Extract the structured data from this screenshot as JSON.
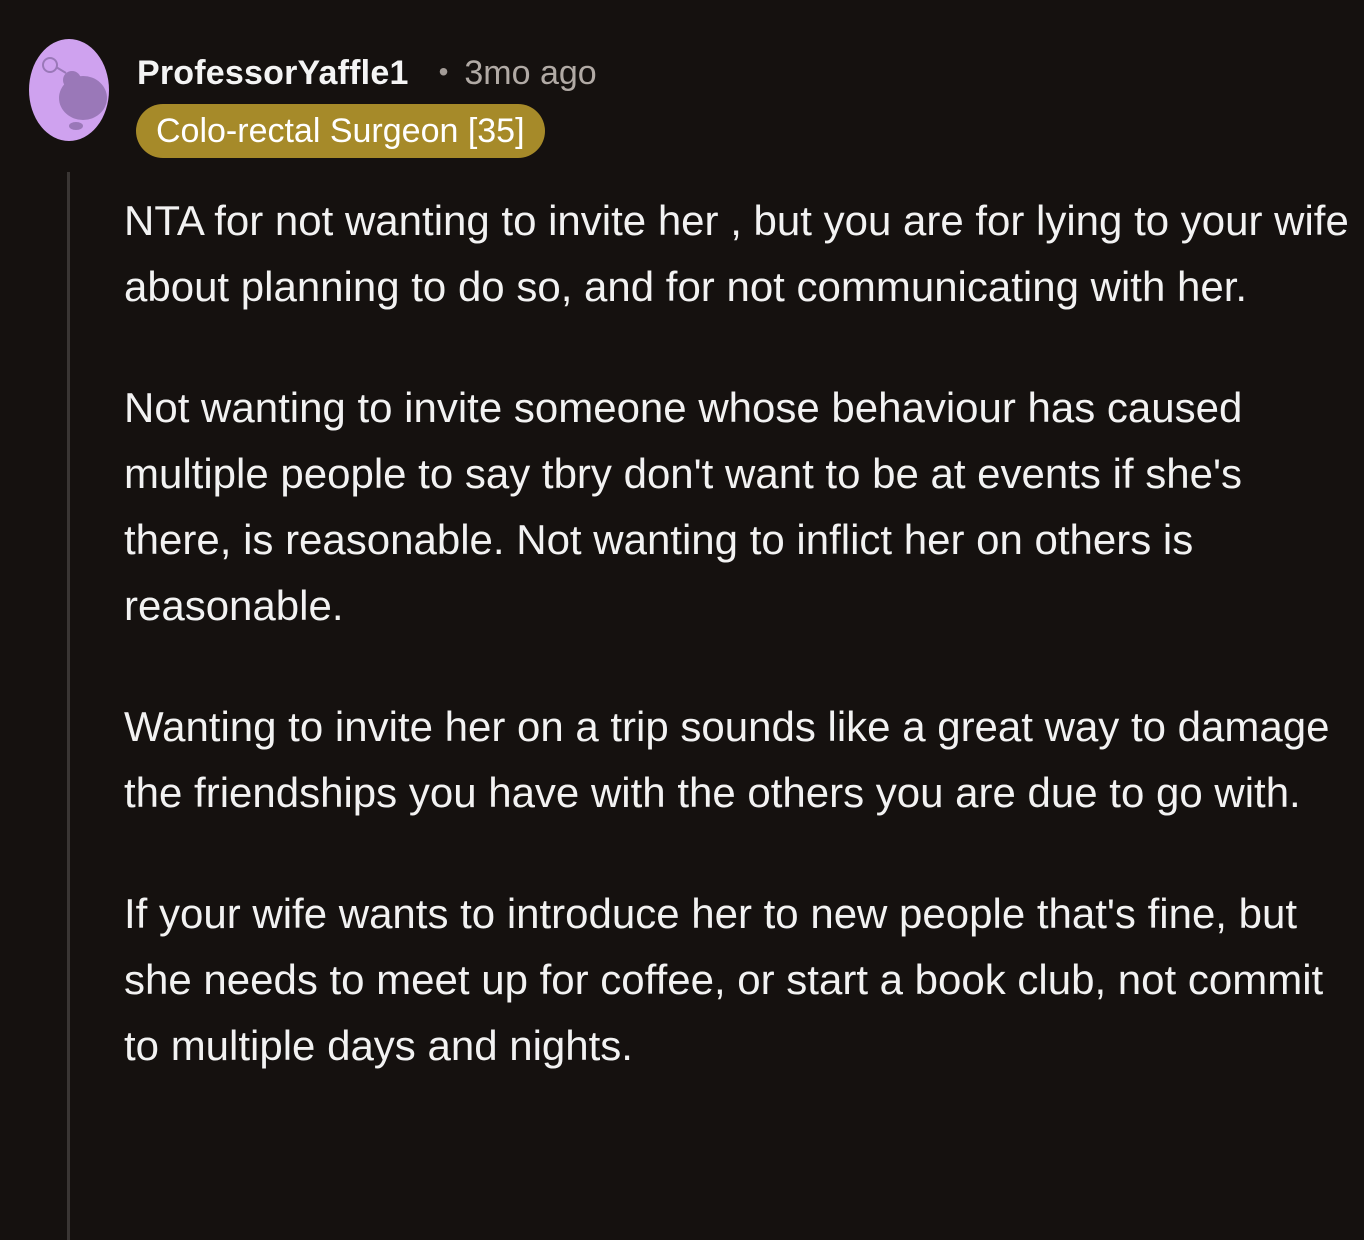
{
  "comment": {
    "author": "ProfessorYaffle1",
    "separator": "•",
    "timestamp": "3mo ago",
    "flair": "Colo-rectal Surgeon [35]",
    "avatar_icon": "snoo-avatar-icon",
    "colors": {
      "background": "#15110f",
      "text": "#f2f2f2",
      "meta_text": "#b1aaa5",
      "flair_background": "#a68a29",
      "avatar_background": "#cfa2ef",
      "avatar_accent": "#9a78b8",
      "thread_line": "#3a3634"
    },
    "paragraphs": [
      "NTA for not wanting to invite her , but you are for lying to your wife about planning to do so, and for not communicating with her.",
      "Not wanting to invite someone whose behaviour has caused multiple people to say tbry don't want to be at events if she's there, is reasonable.  Not wanting to inflict her on others is reasonable.",
      "Wanting to invite her on a trip sounds like a great way to damage the friendships you have with the others you are due to go with.",
      "If your wife wants to introduce her to new people that's fine, but she needs to meet up for coffee, or start a book club, not commit to multiple days and nights."
    ]
  }
}
